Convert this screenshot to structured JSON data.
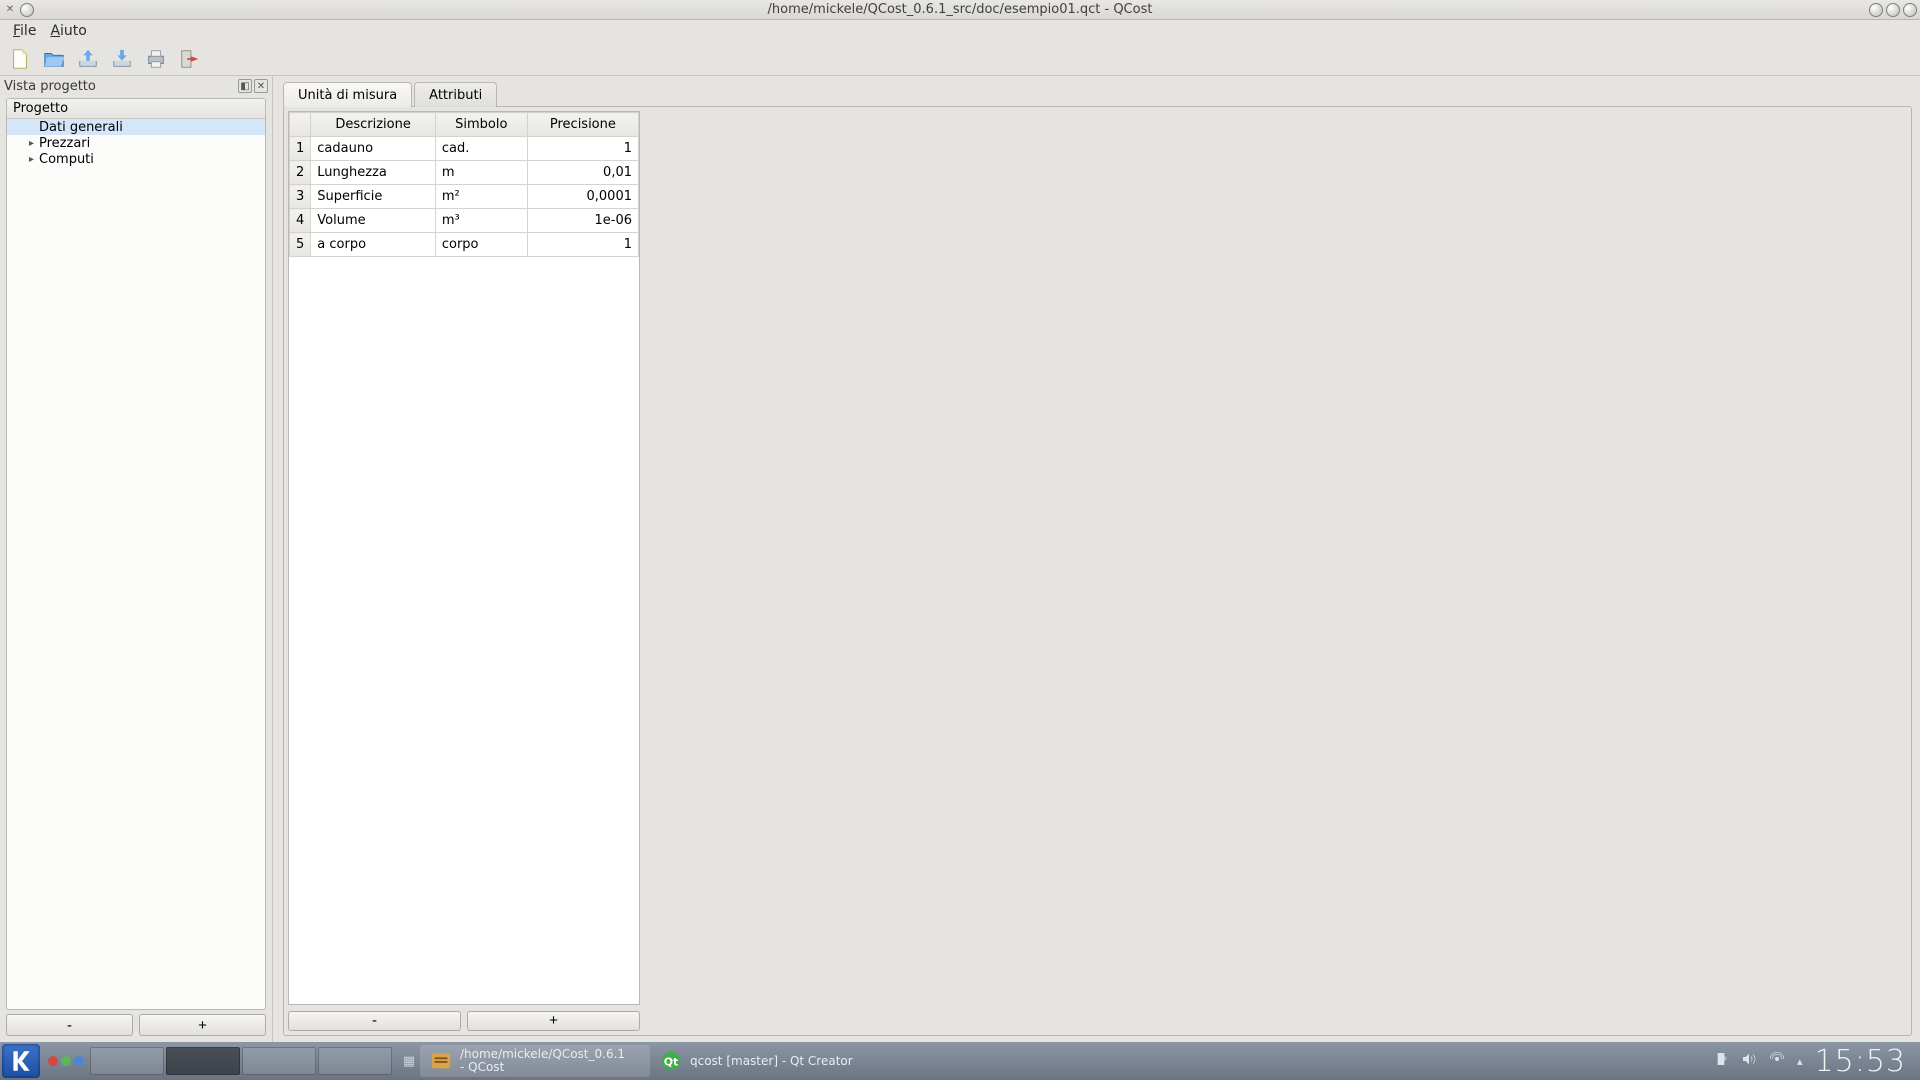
{
  "window": {
    "title": "/home/mickele/QCost_0.6.1_src/doc/esempio01.qct - QCost"
  },
  "menu": {
    "file": "File",
    "file_u": "F",
    "help": "Aiuto",
    "help_u": "A"
  },
  "dock": {
    "title": "Vista progetto",
    "tree_header": "Progetto",
    "nodes": [
      {
        "label": "Dati generali",
        "selected": true,
        "expandable": false
      },
      {
        "label": "Prezzari",
        "selected": false,
        "expandable": true
      },
      {
        "label": "Computi",
        "selected": false,
        "expandable": true
      }
    ],
    "btn_minus": "-",
    "btn_plus": "+"
  },
  "tabs": {
    "active": "Unità di misura",
    "other": "Attributi"
  },
  "table": {
    "headers": [
      "Descrizione",
      "Simbolo",
      "Precisione"
    ],
    "rows": [
      {
        "n": "1",
        "desc": "cadauno",
        "sym": "cad.",
        "prec": "1"
      },
      {
        "n": "2",
        "desc": "Lunghezza",
        "sym": "m",
        "prec": "0,01"
      },
      {
        "n": "3",
        "desc": "Superficie",
        "sym": "m²",
        "prec": "0,0001"
      },
      {
        "n": "4",
        "desc": "Volume",
        "sym": "m³",
        "prec": "1e-06"
      },
      {
        "n": "5",
        "desc": "a corpo",
        "sym": "corpo",
        "prec": "1"
      }
    ],
    "btn_minus": "-",
    "btn_plus": "+"
  },
  "taskbar": {
    "task1_line1": "/home/mickele/QCost_0.6.1",
    "task1_line2": "- QCost",
    "task2": "qcost [master] - Qt Creator",
    "clock": "15:53"
  }
}
